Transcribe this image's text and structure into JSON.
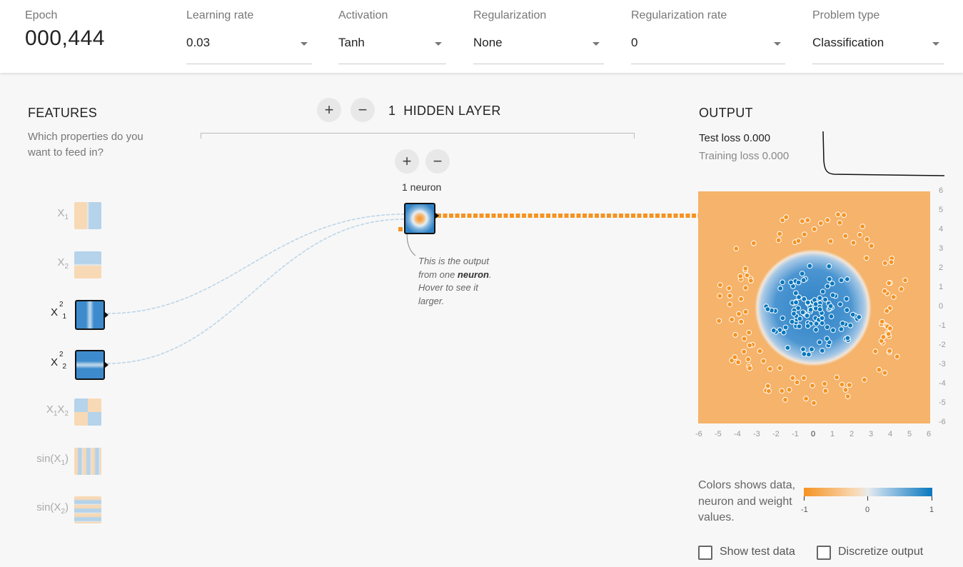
{
  "controls": {
    "epoch": {
      "label": "Epoch",
      "value": "000,444"
    },
    "learning_rate": {
      "label": "Learning rate",
      "value": "0.03"
    },
    "activation": {
      "label": "Activation",
      "value": "Tanh"
    },
    "regularization": {
      "label": "Regularization",
      "value": "None"
    },
    "regularization_rate": {
      "label": "Regularization rate",
      "value": "0"
    },
    "problem_type": {
      "label": "Problem type",
      "value": "Classification"
    }
  },
  "features": {
    "title": "FEATURES",
    "subtitle": "Which properties do you want to feed in?",
    "items": [
      {
        "id": "x1",
        "label": "X",
        "sub": "1",
        "sup": "",
        "sub2": "",
        "active": false
      },
      {
        "id": "x2",
        "label": "X",
        "sub": "2",
        "sup": "",
        "sub2": "",
        "active": false
      },
      {
        "id": "x1sq",
        "label": "X",
        "sub": "1",
        "sup": "2",
        "sub2": "",
        "active": true
      },
      {
        "id": "x2sq",
        "label": "X",
        "sub": "2",
        "sup": "2",
        "sub2": "",
        "active": true
      },
      {
        "id": "x1x2",
        "label": "X",
        "sub": "1",
        "sup": "",
        "sub2": "2",
        "active": false
      },
      {
        "id": "sinx1",
        "label": "sin(X",
        "sub": "1",
        "sup": "",
        "sub2": ")",
        "active": false
      },
      {
        "id": "sinx2",
        "label": "sin(X",
        "sub": "2",
        "sup": "",
        "sub2": ")",
        "active": false
      }
    ]
  },
  "hidden": {
    "add_layer": "+",
    "remove_layer": "−",
    "count": "1",
    "title": "HIDDEN LAYER",
    "add_neuron": "+",
    "remove_neuron": "−",
    "neuron_label": "1 neuron",
    "note_prefix": "This is the output from one ",
    "note_bold": "neuron",
    "note_suffix": ". Hover to see it larger."
  },
  "output": {
    "title": "OUTPUT",
    "test_loss_label": "Test loss",
    "test_loss": "0.000",
    "training_loss_label": "Training loss",
    "training_loss": "0.000",
    "x_ticks": [
      "-6",
      "-5",
      "-4",
      "-3",
      "-2",
      "-1",
      "0",
      "1",
      "2",
      "3",
      "4",
      "5",
      "6"
    ],
    "y_ticks": [
      "6",
      "5",
      "4",
      "3",
      "2",
      "1",
      "0",
      "-1",
      "-2",
      "-3",
      "-4",
      "-5",
      "-6"
    ],
    "legend_text": "Colors shows data, neuron and weight values.",
    "legend_ticks": [
      "-1",
      "0",
      "1"
    ],
    "show_test_data": "Show test data",
    "discretize_output": "Discretize output",
    "show_test_checked": false,
    "discretize_checked": false
  },
  "colors": {
    "orange": "#f59322",
    "blue": "#0877bd",
    "light_orange": "#f5b36b",
    "light_blue": "#5fa3d6"
  }
}
